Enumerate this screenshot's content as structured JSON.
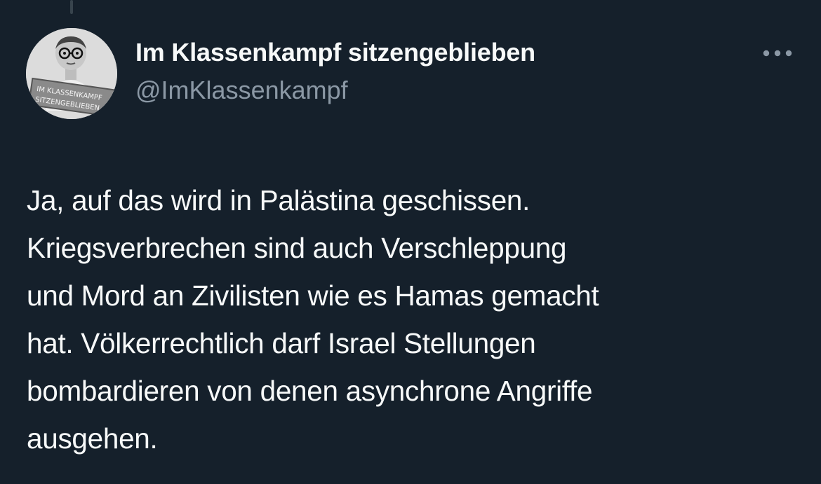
{
  "tweet": {
    "author": {
      "display_name": "Im Klassenkampf sitzengeblieben",
      "handle": "@ImKlassenkampf",
      "avatar_sign_lines": [
        "IM KLASSENKAMPF",
        "SITZENGEBLIEBEN"
      ]
    },
    "more_icon": "more-horizontal-icon",
    "text": "Ja, auf das wird in Palästina geschissen.\nKriegsverbrechen sind auch Verschleppung\nund Mord an Zivilisten wie es Hamas gemacht\nhat. Völkerrechtlich darf Israel Stellungen\nbombardieren von denen asynchrone Angriffe\nausgehen."
  },
  "colors": {
    "background": "#15202b",
    "primary_text": "#f7f9f9",
    "secondary_text": "#8b98a5",
    "thread_line": "#38444d"
  }
}
